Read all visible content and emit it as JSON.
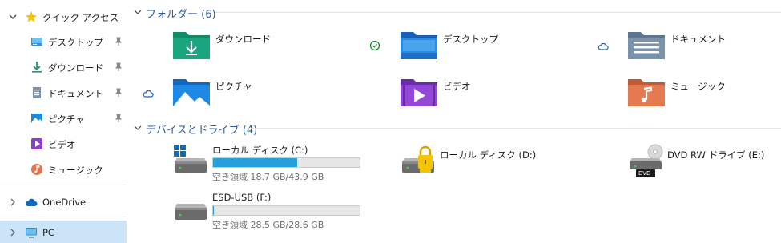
{
  "sidebar": {
    "quick_access": {
      "label": "クイック アクセス"
    },
    "pinned": [
      {
        "label": "デスクトップ",
        "icon": "desktop-icon",
        "pinned": true
      },
      {
        "label": "ダウンロード",
        "icon": "download-icon",
        "pinned": true
      },
      {
        "label": "ドキュメント",
        "icon": "document-icon",
        "pinned": true
      },
      {
        "label": "ピクチャ",
        "icon": "picture-icon",
        "pinned": true
      },
      {
        "label": "ビデオ",
        "icon": "video-icon",
        "pinned": false
      },
      {
        "label": "ミュージック",
        "icon": "music-icon",
        "pinned": false
      }
    ],
    "onedrive": {
      "label": "OneDrive"
    },
    "pc": {
      "label": "PC",
      "selected": true
    }
  },
  "folders_section": {
    "title": "フォルダー (6)",
    "items": [
      {
        "name": "ダウンロード",
        "icon": "download-folder-icon",
        "status": "synced-check"
      },
      {
        "name": "デスクトップ",
        "icon": "desktop-folder-icon",
        "status": "cloud"
      },
      {
        "name": "ドキュメント",
        "icon": "documents-folder-icon",
        "status": ""
      },
      {
        "name": "ピクチャ",
        "icon": "pictures-folder-icon",
        "status": ""
      },
      {
        "name": "ビデオ",
        "icon": "videos-folder-icon",
        "status": ""
      },
      {
        "name": "ミュージック",
        "icon": "music-folder-icon",
        "status": ""
      }
    ],
    "row_status_icons": [
      "cloud"
    ]
  },
  "drives_section": {
    "title": "デバイスとドライブ (4)",
    "items": [
      {
        "name": "ローカル ディスク (C:)",
        "info": "空き領域 18.7 GB/43.9 GB",
        "used_fraction": 0.574,
        "icon": "windows-drive-icon",
        "has_bar": true
      },
      {
        "name": "ローカル ディスク (D:)",
        "info": "",
        "icon": "locked-drive-icon",
        "has_bar": false
      },
      {
        "name": "DVD RW ドライブ (E:)",
        "info": "",
        "icon": "dvd-drive-icon",
        "has_bar": false,
        "badge": "DVD"
      },
      {
        "name": "ESD-USB (F:)",
        "info": "空き領域 28.5 GB/28.6 GB",
        "used_fraction": 0.0035,
        "icon": "usb-drive-icon",
        "has_bar": true
      }
    ]
  },
  "colors": {
    "accent": "#26a0da",
    "section_title": "#2e5d9e",
    "selected_bg": "#cce4f7",
    "star": "#f2c200"
  }
}
